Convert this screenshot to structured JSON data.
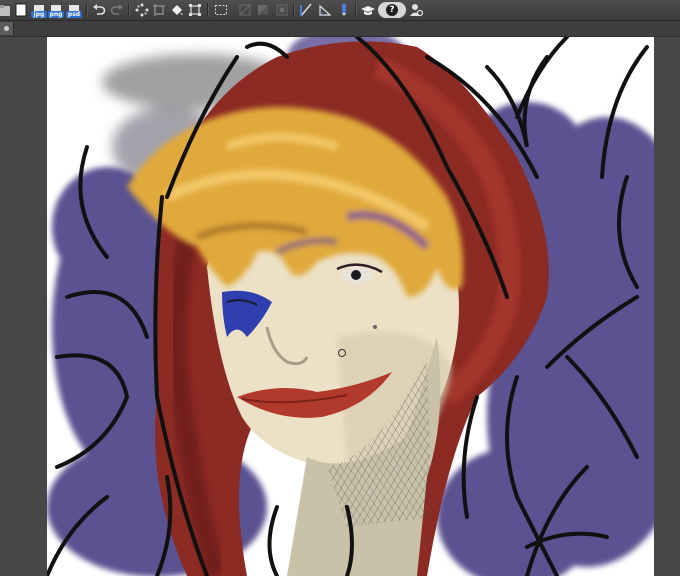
{
  "toolbar": {
    "buttons": [
      {
        "name": "open-file-icon"
      },
      {
        "name": "new-file-icon"
      },
      {
        "name": "export-jpg-icon",
        "format": "jpg"
      },
      {
        "name": "export-png-icon",
        "format": "png"
      },
      {
        "name": "export-psd-icon",
        "format": "psd"
      },
      {
        "name": "undo-icon"
      },
      {
        "name": "redo-icon"
      },
      {
        "name": "loading-icon"
      },
      {
        "name": "crop-icon"
      },
      {
        "name": "fill-icon"
      },
      {
        "name": "transform-icon"
      },
      {
        "name": "selection-icon"
      },
      {
        "name": "select-clear-icon"
      },
      {
        "name": "select-invert-icon"
      },
      {
        "name": "select-fit-icon"
      },
      {
        "name": "ruler-icon"
      },
      {
        "name": "symmetry-icon"
      },
      {
        "name": "pen-tool-icon"
      },
      {
        "name": "graduation-cap-icon"
      },
      {
        "name": "help-icon",
        "label": "?"
      },
      {
        "name": "settings-person-icon"
      }
    ]
  },
  "colors": {
    "toolbar_bg": "#474747",
    "canvas_bg": "#ffffff",
    "hood_red": "#8c2a24",
    "hair_gold": "#e0a93a",
    "shadow_purple": "#4a3f86",
    "skin": "#ece1c6",
    "lip_red": "#b23a2c",
    "eye_blue": "#2f3fb0"
  }
}
